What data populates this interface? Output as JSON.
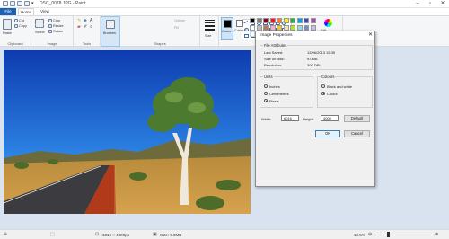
{
  "window": {
    "title": "DSC_0078.JPG - Paint"
  },
  "tabs": {
    "file": "File",
    "home": "Home",
    "view": "View"
  },
  "clipboard": {
    "paste": "Paste",
    "cut": "Cut",
    "copy": "Copy",
    "group": "Clipboard"
  },
  "image_group": {
    "select": "Select",
    "crop": "Crop",
    "resize": "Resize",
    "rotate": "Rotate",
    "group": "Image"
  },
  "tools": {
    "group": "Tools",
    "brushes": "Brushes"
  },
  "shapes_group": {
    "group": "Shapes",
    "outline": "Outline",
    "fill": "Fill"
  },
  "size": {
    "label": "Size"
  },
  "colours": {
    "colour1": "Colour 1",
    "colour2": "Colour 2",
    "group": "Colours",
    "edit": "Edit colours",
    "palette": [
      "#000000",
      "#7f7f7f",
      "#880015",
      "#ed1c24",
      "#ff7f27",
      "#fff200",
      "#22b14c",
      "#00a2e8",
      "#3f48cc",
      "#a349a4",
      "#ffffff",
      "#c3c3c3",
      "#b97a57",
      "#ffaec9",
      "#ffc90e",
      "#efe4b0",
      "#b5e61d",
      "#99d9ea",
      "#7092be",
      "#c8bfe7"
    ]
  },
  "status": {
    "dimensions": "6016 × 4000px",
    "size": "Size: 9.0MB",
    "zoom": "12.5%"
  },
  "dialog": {
    "title": "Image Properties",
    "close": "✕",
    "file_attributes": "File Attributes",
    "last_saved_label": "Last Saved:",
    "last_saved_value": "12/06/2013 15:35",
    "size_label": "Size on disk:",
    "size_value": "9.0MB",
    "resolution_label": "Resolution:",
    "resolution_value": "300 DPI",
    "units": "Units",
    "inches": "Inches",
    "centimetres": "Centimetres",
    "pixels": "Pixels",
    "colours": "Colours",
    "black_white": "Black and white",
    "colour": "Colour",
    "width_label": "Width:",
    "width_value": "6016",
    "height_label": "Height:",
    "height_value": "4000",
    "default_btn": "Default",
    "ok_btn": "OK",
    "cancel_btn": "Cancel"
  }
}
